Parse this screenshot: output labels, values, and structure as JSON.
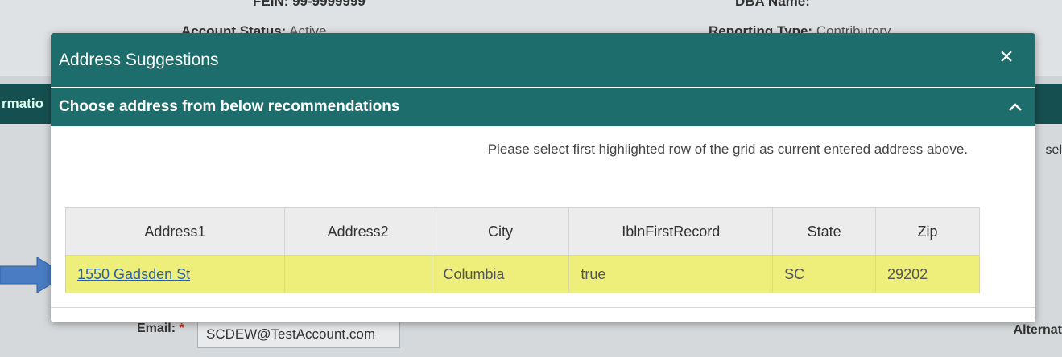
{
  "background": {
    "fein": "FEIN: 99-9999999",
    "dba": "DBA Name:",
    "account_status_label": "Account Status:",
    "account_status_value": "Active",
    "reporting_type_label": "Reporting Type:",
    "reporting_type_value": "Contributory",
    "section_fragment": "rmatio",
    "right_fragment_1": "sel",
    "email_label": "Email:",
    "email_required": "*",
    "email_value": "SCDEW@TestAccount.com",
    "right_fragment_2": "Alternat"
  },
  "modal": {
    "title": "Address Suggestions",
    "close_icon": "close-icon",
    "section_title": "Choose address from below recommendations",
    "collapse_icon": "chevron-up-icon",
    "hint": "Please select first highlighted row of the grid as current entered address above.",
    "columns": [
      "Address1",
      "Address2",
      "City",
      "IblnFirstRecord",
      "State",
      "Zip"
    ],
    "rows": [
      {
        "address1": "1550 Gadsden St",
        "address2": "",
        "city": "Columbia",
        "first_record": "true",
        "state": "SC",
        "zip": "29202"
      }
    ]
  },
  "colors": {
    "header": "#1c6d6b",
    "highlight_row": "#eeee7a",
    "link": "#2b5fa8",
    "arrow": "#4a7cc4"
  }
}
